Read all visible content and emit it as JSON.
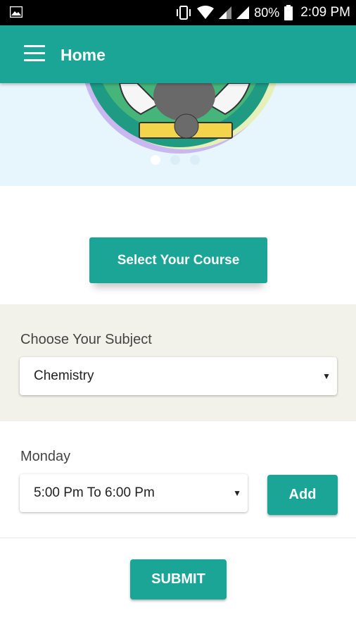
{
  "status_bar": {
    "battery": "80%",
    "time": "2:09 PM",
    "icons": [
      "image-icon",
      "vibrate-icon",
      "wifi-icon",
      "signal-icon",
      "signal-icon",
      "battery-icon"
    ]
  },
  "appbar": {
    "title": "Home",
    "menu_icon": "hamburger-menu-icon",
    "color": "#1aa596"
  },
  "banner": {
    "image_description_icon": "student-illustration",
    "carousel_dots": 3,
    "active_dot": 0
  },
  "course": {
    "button_label": "Select Your Course"
  },
  "subject": {
    "label": "Choose Your Subject",
    "selected": "Chemistry"
  },
  "schedule": {
    "day_label": "Monday",
    "selected_time": "5:00 Pm To 6:00 Pm",
    "add_label": "Add"
  },
  "submit": {
    "label": "SUBMIT"
  },
  "colors": {
    "accent": "#1aa596",
    "banner_bg": "#e7f5fd",
    "section_bg": "#f2f2ea"
  }
}
